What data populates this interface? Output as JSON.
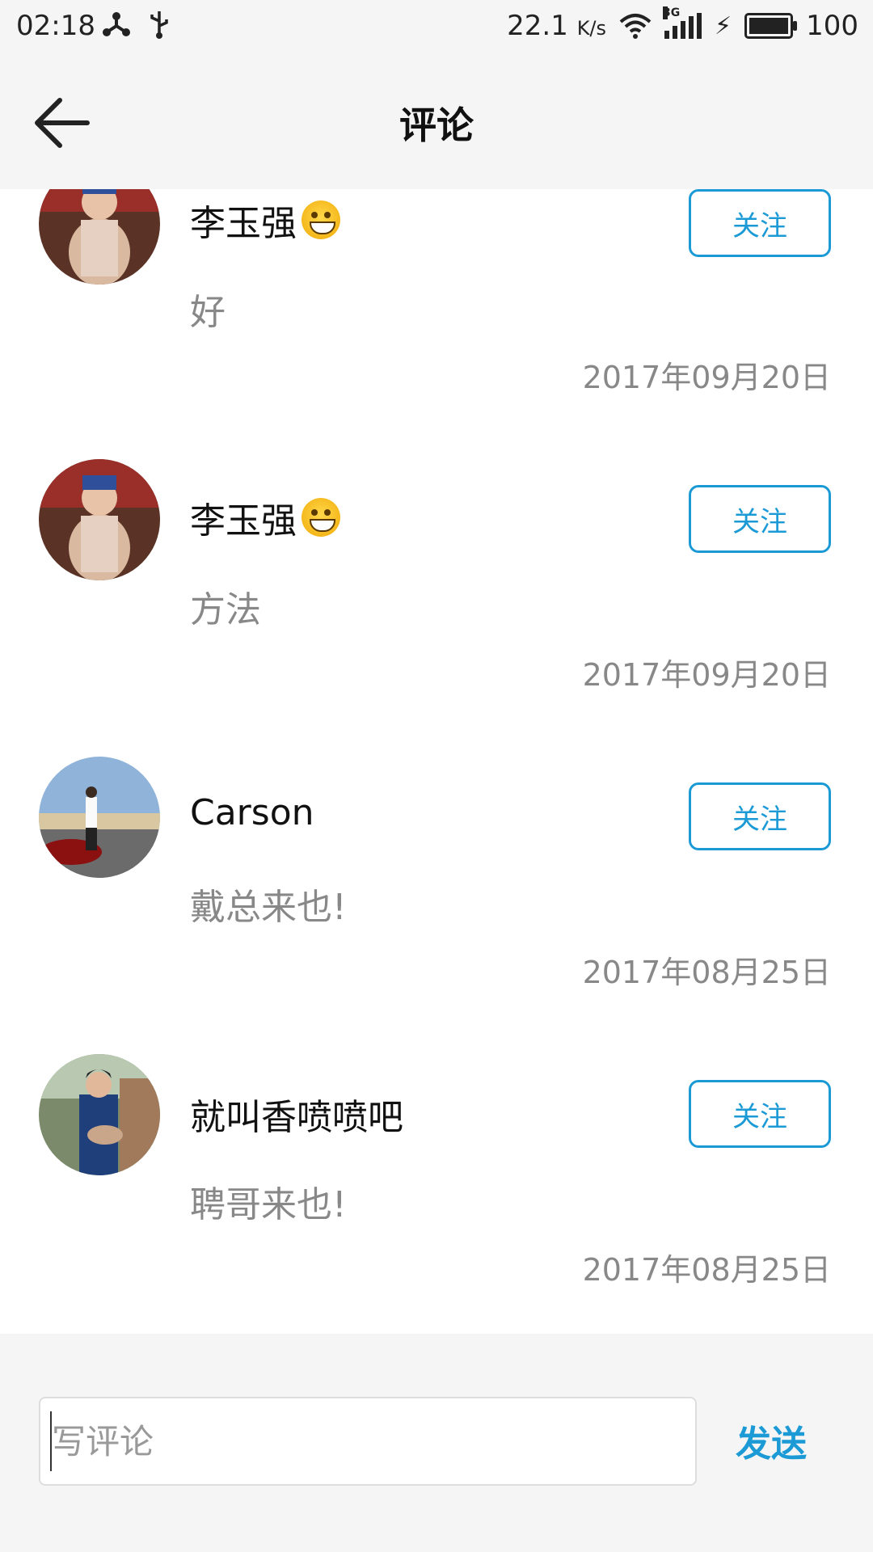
{
  "status_bar": {
    "time": "02:18",
    "net_speed": "22.1",
    "net_unit": "K/s",
    "network_type": "3G",
    "battery": "100"
  },
  "header": {
    "title": "评论"
  },
  "comments": [
    {
      "username": "李玉强",
      "has_emoji": true,
      "follow_label": "关注",
      "text": "好",
      "date": "2017年09月20日"
    },
    {
      "username": "李玉强",
      "has_emoji": true,
      "follow_label": "关注",
      "text": "方法",
      "date": "2017年09月20日"
    },
    {
      "username": "Carson",
      "has_emoji": false,
      "follow_label": "关注",
      "text": "戴总来也!",
      "date": "2017年08月25日"
    },
    {
      "username": "就叫香喷喷吧",
      "has_emoji": false,
      "follow_label": "关注",
      "text": "聘哥来也!",
      "date": "2017年08月25日"
    }
  ],
  "bottom_bar": {
    "input_placeholder": "写评论",
    "send_label": "发送"
  },
  "colors": {
    "accent": "#1b9ad6",
    "secondary_text": "#888888",
    "background": "#f5f5f5"
  }
}
